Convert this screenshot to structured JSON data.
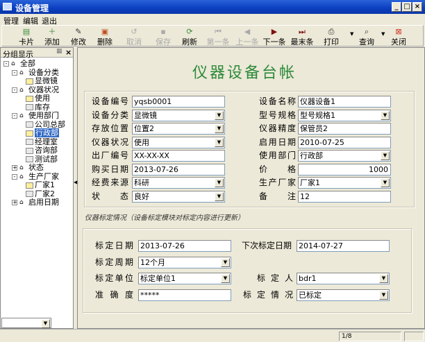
{
  "window": {
    "title": "设备管理",
    "minimize": "_",
    "maximize": "□",
    "close": "×"
  },
  "menu": [
    "管理",
    "编辑",
    "退出"
  ],
  "toolbar": [
    {
      "label": "卡片",
      "icon": "card-icon",
      "enabled": true
    },
    {
      "label": "添加",
      "icon": "add-icon",
      "enabled": true
    },
    {
      "label": "修改",
      "icon": "edit-icon",
      "enabled": true
    },
    {
      "label": "删除",
      "icon": "delete-icon",
      "enabled": true
    },
    {
      "label": "取消",
      "icon": "undo-icon",
      "enabled": false
    },
    {
      "label": "保存",
      "icon": "save-icon",
      "enabled": false
    },
    {
      "label": "刷新",
      "icon": "refresh-icon",
      "enabled": true
    },
    {
      "label": "第一条",
      "icon": "first-record-icon",
      "enabled": false
    },
    {
      "label": "上一条",
      "icon": "prev-record-icon",
      "enabled": false
    },
    {
      "label": "下一条",
      "icon": "next-record-icon",
      "enabled": true
    },
    {
      "label": "最末条",
      "icon": "last-record-icon",
      "enabled": true
    },
    {
      "label": "打印",
      "icon": "print-icon",
      "enabled": true
    },
    {
      "label": "查询",
      "icon": "search-icon",
      "enabled": true
    },
    {
      "label": "关闭",
      "icon": "close-icon",
      "enabled": true
    }
  ],
  "left_panel": {
    "title": "分组显示",
    "close": "×",
    "tree": [
      {
        "label": "全部",
        "level": 0,
        "type": "home",
        "exp": "-"
      },
      {
        "label": "设备分类",
        "level": 1,
        "type": "home",
        "exp": "-"
      },
      {
        "label": "显微镜",
        "level": 2,
        "type": "folder-open"
      },
      {
        "label": "仪器状况",
        "level": 1,
        "type": "home",
        "exp": "-"
      },
      {
        "label": "使用",
        "level": 2,
        "type": "folder-open"
      },
      {
        "label": "库存",
        "level": 2,
        "type": "folder"
      },
      {
        "label": "使用部门",
        "level": 1,
        "type": "home",
        "exp": "-"
      },
      {
        "label": "公司总部",
        "level": 2,
        "type": "folder"
      },
      {
        "label": "行政部",
        "level": 2,
        "type": "folder-open",
        "selected": true
      },
      {
        "label": "经理室",
        "level": 2,
        "type": "folder"
      },
      {
        "label": "咨询部",
        "level": 2,
        "type": "folder"
      },
      {
        "label": "测试部",
        "level": 2,
        "type": "folder"
      },
      {
        "label": "状态",
        "level": 1,
        "type": "home",
        "exp": "+"
      },
      {
        "label": "生产厂家",
        "level": 1,
        "type": "home",
        "exp": "-"
      },
      {
        "label": "厂家1",
        "level": 2,
        "type": "folder-open"
      },
      {
        "label": "厂家2",
        "level": 2,
        "type": "folder"
      },
      {
        "label": "启用日期",
        "level": 1,
        "type": "home",
        "exp": "+"
      }
    ]
  },
  "main": {
    "title": "仪器设备台帐",
    "fields": [
      {
        "label": "设备编号",
        "value": "yqsb0001",
        "dropdown": false,
        "col": 0,
        "row": 0
      },
      {
        "label": "设备分类",
        "value": "显微镜",
        "dropdown": true,
        "col": 0,
        "row": 1
      },
      {
        "label": "存放位置",
        "value": "位置2",
        "dropdown": true,
        "col": 0,
        "row": 2
      },
      {
        "label": "仪器状况",
        "value": "使用",
        "dropdown": true,
        "col": 0,
        "row": 3
      },
      {
        "label": "出厂编号",
        "value": "XX-XX-XX",
        "dropdown": false,
        "col": 0,
        "row": 4
      },
      {
        "label": "购买日期",
        "value": "2013-07-26",
        "dropdown": false,
        "col": 0,
        "row": 5
      },
      {
        "label": "经费来源",
        "value": "科研",
        "dropdown": true,
        "col": 0,
        "row": 6
      },
      {
        "label": "状态",
        "value": "良好",
        "dropdown": true,
        "col": 0,
        "row": 7
      },
      {
        "label": "设备名称",
        "value": "仪器设备1",
        "dropdown": false,
        "col": 1,
        "row": 0
      },
      {
        "label": "型号规格",
        "value": "型号规格1",
        "dropdown": true,
        "col": 1,
        "row": 1
      },
      {
        "label": "仪器精度",
        "value": "保管员2",
        "dropdown": false,
        "col": 1,
        "row": 2
      },
      {
        "label": "启用日期",
        "value": "2010-07-25",
        "dropdown": false,
        "col": 1,
        "row": 3
      },
      {
        "label": "使用部门",
        "value": "行政部",
        "dropdown": true,
        "col": 1,
        "row": 4
      },
      {
        "label": "价格",
        "value": "1000",
        "dropdown": false,
        "col": 1,
        "row": 5,
        "align": "right"
      },
      {
        "label": "生产厂家",
        "value": "厂家1",
        "dropdown": true,
        "col": 1,
        "row": 6
      },
      {
        "label": "备注",
        "value": "12",
        "dropdown": false,
        "col": 1,
        "row": 7
      }
    ],
    "calibration_note": "仪器标定情况（设备标定模块对标定内容进行更新）",
    "calibration": [
      {
        "label": "标定日期",
        "value": "2013-07-26",
        "dropdown": false,
        "col": 0,
        "row": 0
      },
      {
        "label": "标定周期",
        "value": "12个月",
        "dropdown": true,
        "col": 0,
        "row": 1
      },
      {
        "label": "标定单位",
        "value": "标定单位1",
        "dropdown": true,
        "col": 0,
        "row": 2
      },
      {
        "label": "准确度",
        "value": "*****",
        "dropdown": false,
        "col": 0,
        "row": 3
      },
      {
        "label": "下次标定日期",
        "value": "2014-07-27",
        "dropdown": false,
        "col": 1,
        "row": 0
      },
      {
        "label": "标定人",
        "value": "bdr1",
        "dropdown": true,
        "col": 1,
        "row": 2
      },
      {
        "label": "标定情况",
        "value": "已标定",
        "dropdown": true,
        "col": 1,
        "row": 3
      }
    ]
  },
  "status": {
    "pager": "1/8"
  }
}
